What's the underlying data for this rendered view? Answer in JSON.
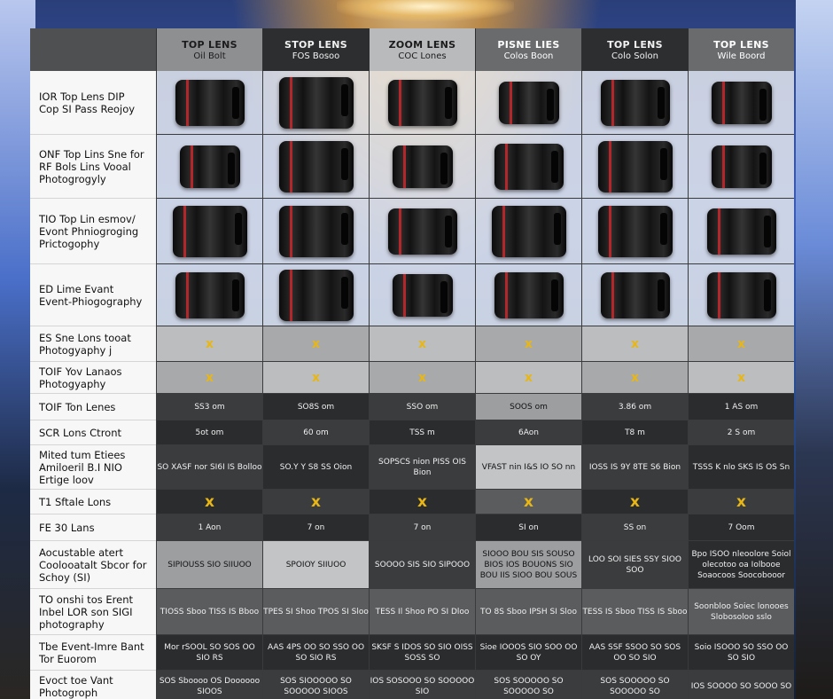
{
  "header": {
    "columns": [
      {
        "title": "TOP LENS",
        "subtitle": "Oil Bolt"
      },
      {
        "title": "STOP LENS",
        "subtitle": "FOS Bosoo"
      },
      {
        "title": "ZOOM LENS",
        "subtitle": "COC Lones"
      },
      {
        "title": "PISNE LIES",
        "subtitle": "Colos Boon"
      },
      {
        "title": "TOP LENS",
        "subtitle": "Colo Solon"
      },
      {
        "title": "TOP LENS",
        "subtitle": "Wile Boord"
      }
    ]
  },
  "rows": [
    {
      "label": "IOR Top Lens DIP Cop SI Pass Reojoy",
      "type": "image"
    },
    {
      "label": "ONF Top Lins Sne for RF Bols Lins Vooal Photogrogyly",
      "type": "image"
    },
    {
      "label": "TIO Top Lin esmov/ Evont Phniogroging Prictogophy",
      "type": "image"
    },
    {
      "label": "ED Lime Evant Event-Phiogography",
      "type": "image"
    },
    {
      "label": "ES Sne Lons tooat Photogyaphy j",
      "type": "mark",
      "mark": "x"
    },
    {
      "label": "TOIF Yov Lanaos Photogyaphy",
      "type": "mark",
      "mark": "x"
    },
    {
      "label": "TOIF Ton Lenes",
      "type": "text",
      "values": [
        "SS3 om",
        "SO8S om",
        "SSO om",
        "SOOS om",
        "3.86 om",
        "1 AS om"
      ]
    },
    {
      "label": "SCR Lons Ctront",
      "type": "text",
      "values": [
        "5ot om",
        "60 om",
        "TSS m",
        "6Aon",
        "T8 m",
        "2 S om"
      ]
    },
    {
      "label": "Mited tum Etiees Amiloeril B.I NIO Ertige loov",
      "type": "text",
      "values": [
        "SO XASF nor SI6I IS Bolloo",
        "SO.Y Y S8 SS Oion",
        "SOPSCS nion PISS OIS Bion",
        "VFAST nin I&S IO SO nn",
        "IOSS IS 9Y 8TE S6 Bion",
        "TSSS K nlo SKS IS OS Sn"
      ]
    },
    {
      "label": "T1 Sftale Lons",
      "type": "mark",
      "mark": "x"
    },
    {
      "label": "FE 30 Lans",
      "type": "text",
      "values": [
        "1 Aon",
        "7 on",
        "7 on",
        "SI on",
        "SS on",
        "7 Oom"
      ]
    },
    {
      "label": "Aocustable atert Coolooatalt Sbcor for Schoy (SI)",
      "type": "text",
      "values": [
        "SIPIOUSS SIO SIIUOO",
        "SPOIOY SIIUOO",
        "SOOOO SIS SIO SIPOOO",
        "SIOOO BOU SIS SOUSO BIOS IOS BOUONS SIO BOU IIS SIOO BOU SOUS",
        "LOO SOI SIES SSY SIOO SOO",
        "Bpo ISOO nleoolore Soiol olecotoo oa Iolbooe Soaocoos Soocobooor"
      ]
    },
    {
      "label": "TO onshi tos Erent Inbel LOR son SIGI photography",
      "type": "text",
      "values": [
        "TIOSS Sboo TISS IS Bboo",
        "TPES SI Shoo TPOS SI Sloo",
        "TESS Il Shoo PO SI Dloo",
        "TO 8S Sboo IPSH SI Sloo",
        "TESS IS Sboo TISS IS Sboo",
        "Soonbloo Soiec lonooes Slobosoloo sslo"
      ]
    },
    {
      "label": "Tbe Event-Imre Bant Tor Euorom",
      "type": "text",
      "values": [
        "Mor rSOOL SO SOS OO SIO RS",
        "AAS 4PS OO SO SSO OO SO SIO RS",
        "SKSF S IDOS SO SIO OISS SOSS SO",
        "Sioe IOOOS SIO SOO OO SO OY",
        "AAS SSF SSOO SO SOS OO SO SIO",
        "Soio ISOOO SO SSO OO SO SIO"
      ]
    },
    {
      "label": "Evoct toe Vant Photogroph",
      "type": "text",
      "values": [
        "SOS Sboooo OS Doooooo SIOOS",
        "SOS SIOOOOO SO SOOOOO SIOOS",
        "IOS SOSOOO SO SOOOOO SIO",
        "SOS SOOOOO SO SOOOOO SO",
        "SOS SOOOOO SO SOOOOO SO",
        "IOS SOOOO SO SOOO SO"
      ]
    }
  ]
}
